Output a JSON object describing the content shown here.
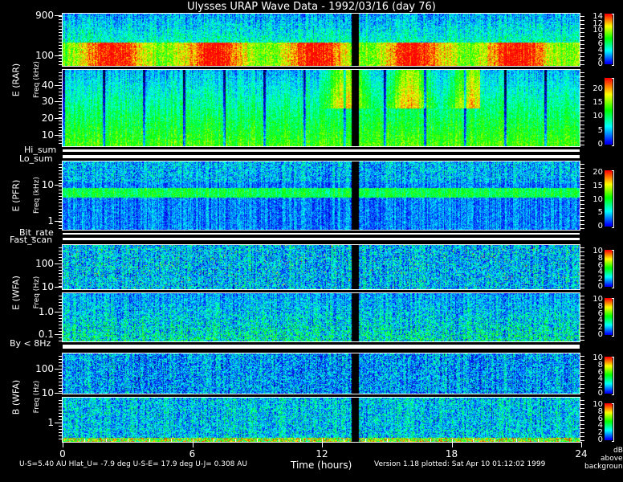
{
  "chart_data": {
    "type": "heatmap",
    "title": "Ulysses URAP Wave Data - 1992/03/16  (day 76)",
    "xlabel": "Time (hours)",
    "xlim": [
      0,
      24
    ],
    "xticks": [
      "0",
      "6",
      "12",
      "18",
      "24"
    ],
    "colorbar_label": [
      "dB",
      "above",
      "background"
    ],
    "colormap": [
      "#000000",
      "#0000ff",
      "#00ffff",
      "#00ff00",
      "#ffff00",
      "#ff0000"
    ],
    "data_gap_hours": [
      13.4,
      13.7
    ],
    "panels": [
      {
        "id": "rar-high",
        "group_label": "E (RAR)",
        "freq_label": "Freq (kHz)",
        "scale": "log",
        "ylim": [
          56,
          980
        ],
        "yticks": [
          100,
          900
        ],
        "ytick_labels": [
          "100",
          "900"
        ],
        "cbar_max": 15,
        "cbar_ticks": [
          "0",
          "2",
          "4",
          "6",
          "8",
          "10",
          "12",
          "14"
        ]
      },
      {
        "id": "rar-low",
        "scale": "linear",
        "ylim": [
          3,
          49
        ],
        "yticks": [
          10,
          20,
          30,
          40
        ],
        "ytick_labels": [
          "10",
          "20",
          "30",
          "40"
        ],
        "cbar_max": 24,
        "cbar_ticks": [
          "0",
          "5",
          "10",
          "15",
          "20"
        ]
      },
      {
        "id": "pfr",
        "group_label": "E (PFR)",
        "freq_label": "Freq (kHz)",
        "scale": "log",
        "ylim": [
          0.57,
          44
        ],
        "yticks": [
          1,
          10
        ],
        "ytick_labels": [
          "1",
          "10"
        ],
        "cbar_max": 21,
        "cbar_ticks": [
          "0",
          "5",
          "10",
          "15",
          "20"
        ]
      },
      {
        "id": "wfa-e-high",
        "group_label": "E (WFA)",
        "freq_label": "Freq (Hz)",
        "scale": "log",
        "ylim": [
          7.9,
          620
        ],
        "yticks": [
          10,
          100
        ],
        "ytick_labels": [
          "10",
          "100"
        ],
        "cbar_max": 10.5,
        "cbar_ticks": [
          "0",
          "2",
          "4",
          "6",
          "8",
          "10"
        ]
      },
      {
        "id": "wfa-e-low",
        "scale": "log",
        "ylim": [
          0.048,
          6.6
        ],
        "yticks": [
          0.1,
          1
        ],
        "ytick_labels": [
          "0.1",
          "1.0"
        ],
        "cbar_max": 10.5,
        "cbar_ticks": [
          "0",
          "2",
          "4",
          "6",
          "8",
          "10"
        ]
      },
      {
        "id": "wfa-b-high",
        "group_label": "B (WFA)",
        "freq_label": "Freq (Hz)",
        "scale": "log",
        "ylim": [
          9.2,
          430
        ],
        "yticks": [
          10,
          100
        ],
        "ytick_labels": [
          "10",
          "100"
        ],
        "cbar_max": 10.5,
        "cbar_ticks": [
          "0",
          "2",
          "4",
          "6",
          "8",
          "10"
        ]
      },
      {
        "id": "wfa-b-low",
        "scale": "log",
        "ylim": [
          0.16,
          10.8
        ],
        "yticks": [
          1
        ],
        "ytick_labels": [
          "1"
        ],
        "cbar_max": 10.5,
        "cbar_ticks": [
          "0",
          "2",
          "4",
          "6",
          "8",
          "10"
        ]
      }
    ],
    "strip_labels": [
      "Hi_sum",
      "Lo_sum",
      "Bit_rate",
      "Fast_scan",
      "By < 8Hz"
    ]
  },
  "footer": {
    "ephemeris": "U-S=5.40 AU  Hlat_U= -7.9 deg  U-S-E= 17.9 deg  U-J= 0.308 AU",
    "version": "Version 1.18 plotted: Sat Apr 10 01:12:02 1999"
  }
}
